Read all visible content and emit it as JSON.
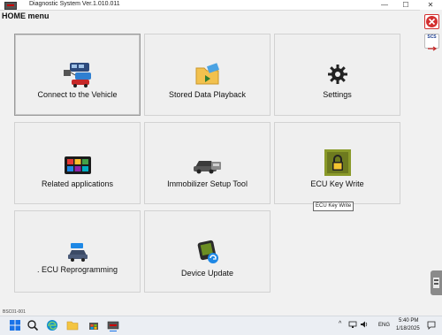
{
  "window": {
    "title": "Diagnostic System Ver.1.010.011",
    "minimize_glyph": "—",
    "maximize_glyph": "☐",
    "close_glyph": "✕"
  },
  "home_menu_label": "HOME menu",
  "tiles": [
    {
      "label": "Connect to the Vehicle",
      "icon": "vehicle-connect-icon"
    },
    {
      "label": "Stored Data Playback",
      "icon": "folder-playback-icon"
    },
    {
      "label": "Settings",
      "icon": "gear-icon"
    },
    {
      "label": "Related applications",
      "icon": "apps-grid-icon"
    },
    {
      "label": "Immobilizer Setup Tool",
      "icon": "immobilizer-icon"
    },
    {
      "label": "ECU Key Write",
      "icon": "ecu-lock-icon"
    },
    {
      "label": ". ECU Reprogramming",
      "icon": "ecu-reprogram-icon"
    },
    {
      "label": "Device Update",
      "icon": "device-update-icon"
    }
  ],
  "tooltip": "ECU Key Write",
  "sidebar": {
    "close_label": "✕",
    "scs_label": "SCS"
  },
  "status_code": "BSC01-001",
  "taskbar": {
    "language": "ENG",
    "time": "5:40 PM",
    "date": "1/18/2025",
    "tray_arrow": "^"
  },
  "colors": {
    "accent_red": "#d32f2f",
    "ecu_green": "#8a9a2a",
    "taskbar_bg": "#ebeef3"
  }
}
